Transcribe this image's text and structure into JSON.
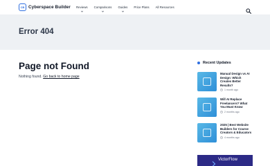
{
  "header": {
    "logo_text": "Cyberspace Builder",
    "logo_mark": "CB",
    "nav": [
      {
        "label": "Reviews",
        "has_dropdown": true
      },
      {
        "label": "Comparisons",
        "has_dropdown": true
      },
      {
        "label": "Guides",
        "has_dropdown": true
      },
      {
        "label": "Price Plans",
        "has_dropdown": false
      },
      {
        "label": "All Resources",
        "has_dropdown": false
      }
    ],
    "search_icon": "search-icon"
  },
  "hero": {
    "title": "Error 404"
  },
  "main": {
    "title": "Page not Found",
    "text": "Nothing found.",
    "link": "Go back to home page"
  },
  "sidebar": {
    "title": "Recent Updates",
    "posts": [
      {
        "title": "Manual Design vs AI Design: Which Creates Better Results?",
        "meta": "1 month ago"
      },
      {
        "title": "Will AI Replace Freelancers? What You Must Know",
        "meta": "2 months ago"
      },
      {
        "title": "2025 | Best Website Builders for Course Creators & Educators",
        "meta": "4 months ago"
      }
    ]
  },
  "ad": {
    "text": "VictorFlow"
  },
  "colors": {
    "accent": "#2f6fe0",
    "hero_bg": "#eef1f4",
    "ad_bg": "#2c2a86"
  }
}
